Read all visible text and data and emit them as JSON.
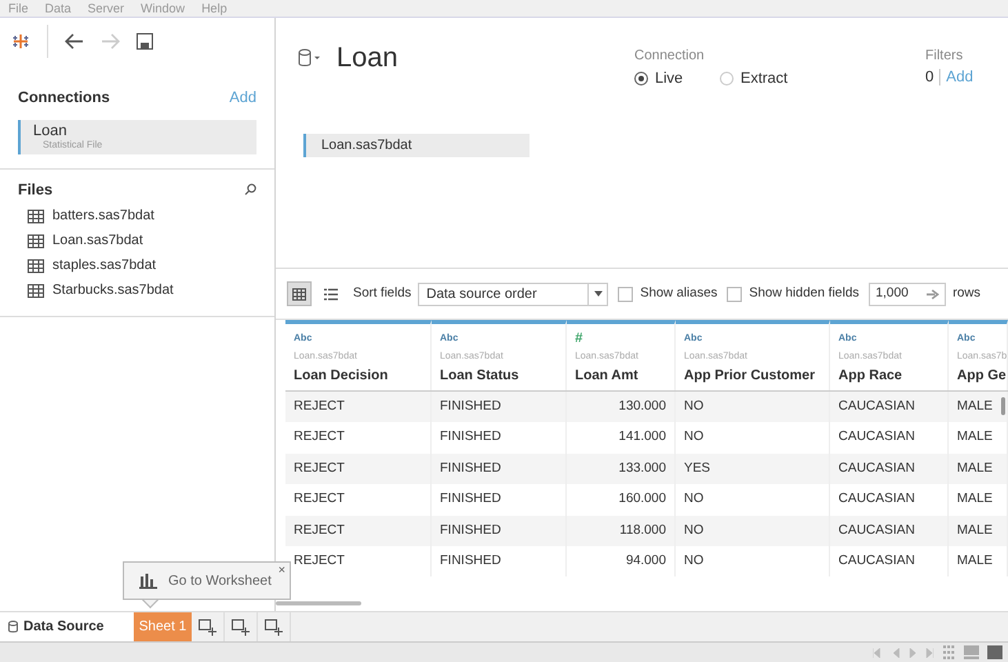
{
  "menu": [
    "File",
    "Data",
    "Server",
    "Window",
    "Help"
  ],
  "connections": {
    "title": "Connections",
    "add": "Add",
    "items": [
      {
        "name": "Loan",
        "type": "Statistical File",
        "selected": true
      }
    ]
  },
  "files": {
    "title": "Files",
    "items": [
      "batters.sas7bdat",
      "Loan.sas7bdat",
      "staples.sas7bdat",
      "Starbucks.sas7bdat"
    ]
  },
  "datasource": {
    "name": "Loan",
    "connection": {
      "label": "Connection",
      "options": [
        {
          "label": "Live",
          "selected": true
        },
        {
          "label": "Extract",
          "selected": false
        }
      ]
    },
    "filters": {
      "label": "Filters",
      "count": "0",
      "add": "Add"
    },
    "tables": [
      "Loan.sas7bdat"
    ]
  },
  "grid_toolbar": {
    "view_modes": [
      {
        "kind": "grid",
        "selected": true
      },
      {
        "kind": "list",
        "selected": false
      }
    ],
    "sort_label": "Sort fields",
    "sort_value": "Data source order",
    "show_aliases": {
      "label": "Show aliases",
      "checked": false
    },
    "show_hidden": {
      "label": "Show hidden fields",
      "checked": false
    },
    "rows_value": "1,000",
    "rows_label": "rows"
  },
  "table": {
    "columns": [
      {
        "kind": "text",
        "type_label": "Abc",
        "source": "Loan.sas7bdat",
        "name": "Loan Decision"
      },
      {
        "kind": "text",
        "type_label": "Abc",
        "source": "Loan.sas7bdat",
        "name": "Loan Status"
      },
      {
        "kind": "number",
        "type_label": "#",
        "source": "Loan.sas7bdat",
        "name": "Loan Amt"
      },
      {
        "kind": "text",
        "type_label": "Abc",
        "source": "Loan.sas7bdat",
        "name": "App Prior Customer"
      },
      {
        "kind": "text",
        "type_label": "Abc",
        "source": "Loan.sas7bdat",
        "name": "App Race"
      },
      {
        "kind": "text",
        "type_label": "Abc",
        "source": "Loan.sas7b",
        "name": "App Ge"
      }
    ],
    "rows": [
      [
        "REJECT",
        "FINISHED",
        "130.000",
        "NO",
        "CAUCASIAN",
        "MALE"
      ],
      [
        "REJECT",
        "FINISHED",
        "141.000",
        "NO",
        "CAUCASIAN",
        "MALE"
      ],
      [
        "REJECT",
        "FINISHED",
        "133.000",
        "YES",
        "CAUCASIAN",
        "MALE"
      ],
      [
        "REJECT",
        "FINISHED",
        "160.000",
        "NO",
        "CAUCASIAN",
        "MALE"
      ],
      [
        "REJECT",
        "FINISHED",
        "118.000",
        "NO",
        "CAUCASIAN",
        "MALE"
      ],
      [
        "REJECT",
        "FINISHED",
        "94.000",
        "NO",
        "CAUCASIAN",
        "MALE"
      ]
    ]
  },
  "tooltip": {
    "text": "Go to Worksheet",
    "close": "×"
  },
  "tabs": [
    {
      "label": "Data Source",
      "kind": "datasource",
      "selected": false
    },
    {
      "label": "Sheet 1",
      "kind": "sheet",
      "selected": true
    }
  ]
}
